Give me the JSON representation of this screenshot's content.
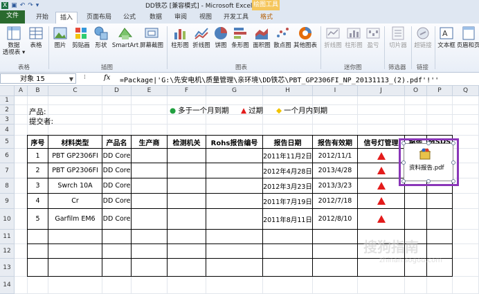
{
  "window": {
    "title": "DD铁芯 [兼容模式] - Microsoft Excel",
    "context_group": "绘图工具"
  },
  "tabs": [
    "文件",
    "开始",
    "插入",
    "页面布局",
    "公式",
    "数据",
    "审阅",
    "视图",
    "开发工具",
    "格式"
  ],
  "active_tab": "插入",
  "ribbon": {
    "buttons": {
      "pivot": "数据\n透视表 ▾",
      "table": "表格",
      "picture": "图片",
      "clipart": "剪贴画",
      "shapes": "形状",
      "smartart": "SmartArt",
      "screenshot": "屏幕截图",
      "bar": "柱形图",
      "line": "折线图",
      "pie": "饼图",
      "hbar": "条形图",
      "area": "面积图",
      "scatter": "散点图",
      "other": "其他图表",
      "spark_line": "折线图",
      "spark_col": "柱形图",
      "spark_wl": "盈亏",
      "slicer": "切片器",
      "hyperlink": "超链接",
      "textbox": "文本框",
      "headerfooter": "页眉和页"
    },
    "groups": {
      "tables": "表格",
      "illustrations": "插图",
      "charts": "图表",
      "sparklines": "迷你图",
      "filter": "筛选器",
      "links": "链接"
    }
  },
  "formula_bar": {
    "name_box": "对象 15",
    "fx": "fx",
    "formula": "=Package|'G:\\先安电机\\质量管理\\亲环境\\DD铁芯\\PBT_GP2306FI_NP_20131113_(2).pdf'!''"
  },
  "columns": [
    "A",
    "B",
    "C",
    "D",
    "E",
    "F",
    "G",
    "H",
    "I",
    "J",
    "O",
    "P",
    "Q",
    "R"
  ],
  "rows": [
    "1",
    "2",
    "3",
    "4",
    "5",
    "6",
    "7",
    "8",
    "9",
    "10",
    "11",
    "12",
    "13",
    "14"
  ],
  "sheet": {
    "product_label": "产品:",
    "submitter_label": "提交者:",
    "legend": [
      {
        "symbol": "●",
        "color": "#22a040",
        "text": "多于一个月到期"
      },
      {
        "symbol": "▲",
        "color": "#e31b1b",
        "text": "过期"
      },
      {
        "symbol": "◆",
        "color": "#f2c400",
        "text": "一个月内到期"
      }
    ],
    "headers": [
      "序号",
      "材料类型",
      "产品名",
      "生产商",
      "检测机关",
      "Rohs报告编号",
      "报告日期",
      "报告有效期",
      "信号灯管理",
      "报告",
      "MSDS"
    ],
    "rows": [
      {
        "no": "1",
        "material": "PBT GP2306FI",
        "product": "DD Core",
        "date": "2011年11月2日",
        "valid": "2012/11/1"
      },
      {
        "no": "2",
        "material": "PBT GP2306FI",
        "product": "DD Core",
        "date": "2012年4月28日",
        "valid": "2013/4/28"
      },
      {
        "no": "3",
        "material": "Swrch 10A",
        "product": "DD Core",
        "date": "2012年3月23日",
        "valid": "2013/3/23"
      },
      {
        "no": "4",
        "material": "Cr",
        "product": "DD Core",
        "date": "2011年7月19日",
        "valid": "2012/7/18"
      },
      {
        "no": "5",
        "material": "Garfilm EM6",
        "product": "DD Core",
        "date": "2011年8月11日",
        "valid": "2012/8/10"
      }
    ]
  },
  "embedded_object": {
    "label": "资料报告.pdf",
    "icon": "package-icon"
  },
  "watermark": {
    "text": "搜狗指南",
    "url": "zhinan.sogou.com"
  }
}
